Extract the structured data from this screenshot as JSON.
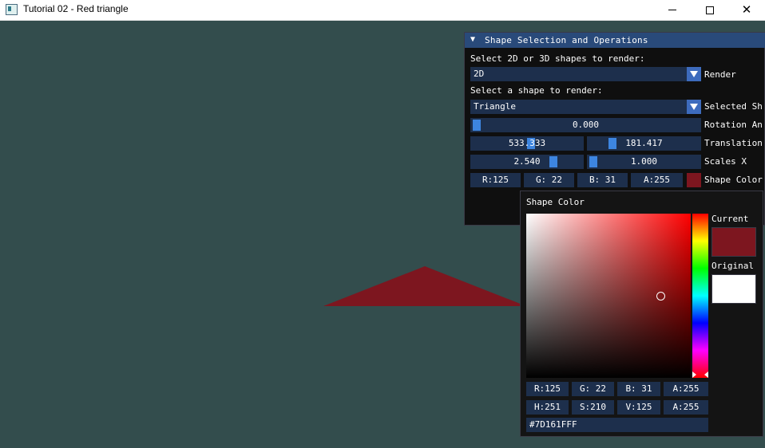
{
  "window": {
    "title": "Tutorial 02 - Red triangle"
  },
  "scene": {
    "background_color": "#334d4d",
    "triangle_color": "#7d161f"
  },
  "panel": {
    "title": "Shape Selection and Operations",
    "select_dim_prompt": "Select 2D or 3D shapes to render:",
    "dim_value": "2D",
    "dim_label": "Render",
    "select_shape_prompt": "Select a shape to render:",
    "shape_value": "Triangle",
    "shape_label": "Selected Sh",
    "rotation_value": "0.000",
    "rotation_label": "Rotation An",
    "translation_x": "533.333",
    "translation_y": "181.417",
    "translation_label": "Translation",
    "scale_x": "2.540",
    "scale_y": "1.000",
    "scale_label": "Scales X",
    "rgba": {
      "r": "R:125",
      "g": "G: 22",
      "b": "B: 31",
      "a": "A:255"
    },
    "color_label": "Shape Color",
    "color_hex_swatch": "#7d161f"
  },
  "picker": {
    "title": "Shape Color",
    "current_label": "Current",
    "original_label": "Original",
    "current_color": "#7d161f",
    "original_color": "#ffffff",
    "rgba": {
      "r": "R:125",
      "g": "G: 22",
      "b": "B: 31",
      "a": "A:255"
    },
    "hsva": {
      "h": "H:251",
      "s": "S:210",
      "v": "V:125",
      "a": "A:255"
    },
    "hex": "#7D161FFF"
  }
}
